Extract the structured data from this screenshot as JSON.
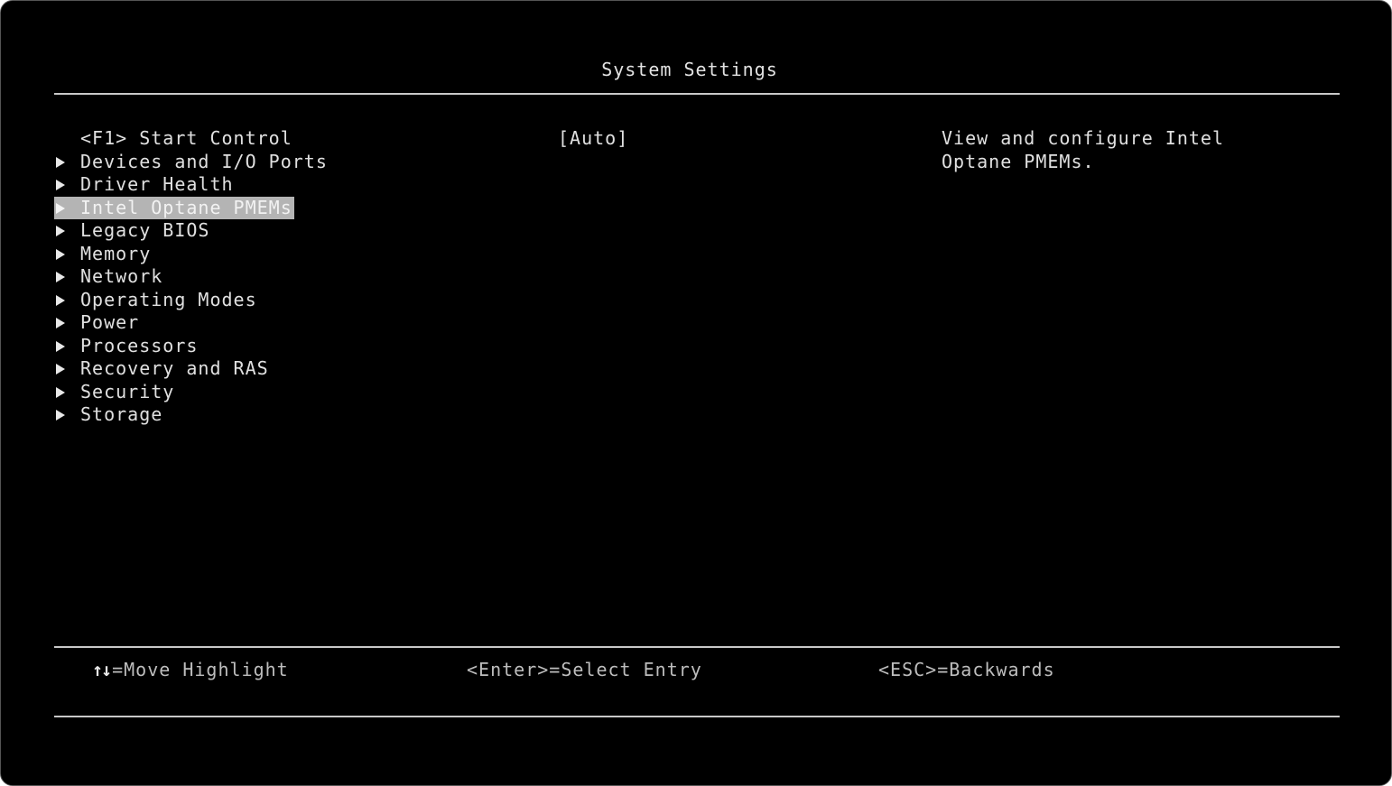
{
  "header": {
    "title": "System Settings"
  },
  "menu": {
    "items": [
      {
        "label": "<F1> Start Control",
        "has_submenu": false,
        "selected": false
      },
      {
        "label": "Devices and I/O Ports",
        "has_submenu": true,
        "selected": false
      },
      {
        "label": "Driver Health",
        "has_submenu": true,
        "selected": false
      },
      {
        "label": "Intel Optane PMEMs",
        "has_submenu": true,
        "selected": true
      },
      {
        "label": "Legacy BIOS",
        "has_submenu": true,
        "selected": false
      },
      {
        "label": "Memory",
        "has_submenu": true,
        "selected": false
      },
      {
        "label": "Network",
        "has_submenu": true,
        "selected": false
      },
      {
        "label": "Operating Modes",
        "has_submenu": true,
        "selected": false
      },
      {
        "label": "Power",
        "has_submenu": true,
        "selected": false
      },
      {
        "label": "Processors",
        "has_submenu": true,
        "selected": false
      },
      {
        "label": "Recovery and RAS",
        "has_submenu": true,
        "selected": false
      },
      {
        "label": "Security",
        "has_submenu": true,
        "selected": false
      },
      {
        "label": "Storage",
        "has_submenu": true,
        "selected": false
      }
    ]
  },
  "start_control": {
    "value": "[Auto]"
  },
  "help": {
    "text_line1": "View and configure Intel",
    "text_line2": "Optane PMEMs."
  },
  "footer": {
    "move_icon": "↑↓",
    "move_label": "=Move Highlight",
    "enter_label": "<Enter>=Select Entry",
    "esc_label": "<ESC>=Backwards"
  },
  "colors": {
    "background": "#000000",
    "text": "#e0e0e0",
    "highlight": "#b4b4b4"
  }
}
